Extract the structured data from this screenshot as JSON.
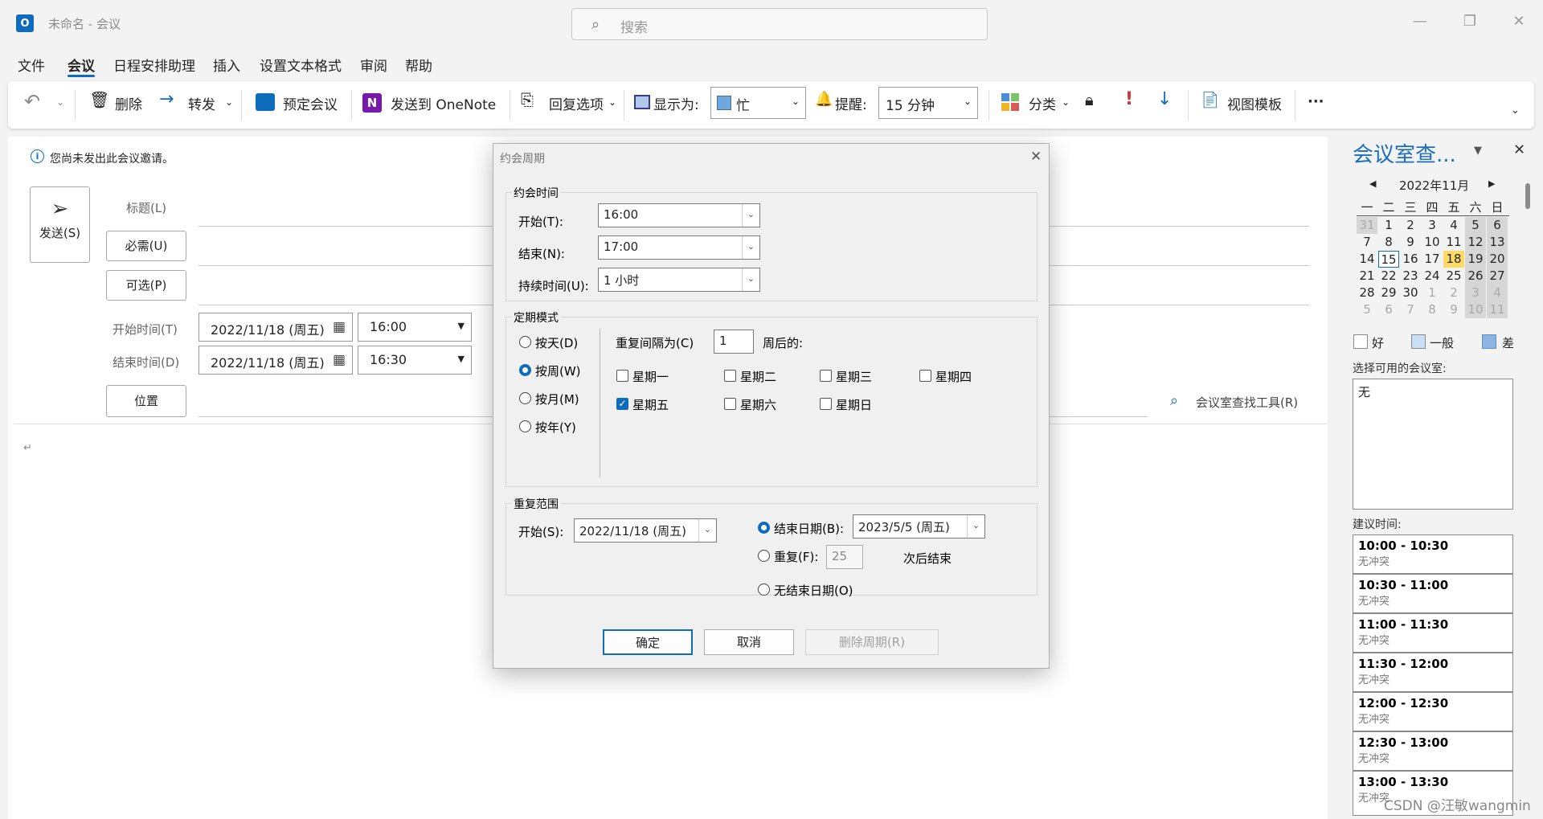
{
  "window": {
    "app_icon": "O",
    "title": "未命名 - 会议",
    "search_placeholder": "搜索",
    "minimize": "—",
    "restore": "❐",
    "close": "✕"
  },
  "menu": [
    "文件",
    "会议",
    "日程安排助理",
    "插入",
    "设置文本格式",
    "审阅",
    "帮助"
  ],
  "ribbon": {
    "undo": "↶",
    "delete": "删除",
    "forward": "转发",
    "book_meeting": "预定会议",
    "send_onenote": "发送到 OneNote",
    "reply_options": "回复选项",
    "show_as_label": "显示为:",
    "show_as_value": "忙",
    "reminder_label": "提醒:",
    "reminder_value": "15 分钟",
    "categorize": "分类",
    "view_templates": "视图模板",
    "more": "···"
  },
  "compose": {
    "info": "您尚未发出此会议邀请。",
    "send": "发送(S)",
    "title_label": "标题(L)",
    "required": "必需(U)",
    "optional": "可选(P)",
    "start_label": "开始时间(T)",
    "end_label": "结束时间(D)",
    "start_date": "2022/11/18 (周五)",
    "start_time": "16:00",
    "end_date": "2022/11/18 (周五)",
    "end_time": "16:30",
    "location": "位置",
    "room_finder_tool": "会议室查找工具(R)",
    "body_mark": "↵"
  },
  "room_finder": {
    "title": "会议室查...",
    "month": "2022年11月",
    "weekdays": [
      "一",
      "二",
      "三",
      "四",
      "五",
      "六",
      "日"
    ],
    "weeks": [
      [
        "31",
        "1",
        "2",
        "3",
        "4",
        "5",
        "6"
      ],
      [
        "7",
        "8",
        "9",
        "10",
        "11",
        "12",
        "13"
      ],
      [
        "14",
        "15",
        "16",
        "17",
        "18",
        "19",
        "20"
      ],
      [
        "21",
        "22",
        "23",
        "24",
        "25",
        "26",
        "27"
      ],
      [
        "28",
        "29",
        "30",
        "1",
        "2",
        "3",
        "4"
      ],
      [
        "5",
        "6",
        "7",
        "8",
        "9",
        "10",
        "11"
      ]
    ],
    "legend_good": "好",
    "legend_fair": "一般",
    "legend_poor": "差",
    "rooms_label": "选择可用的会议室:",
    "rooms_value": "无",
    "suggested_label": "建议时间:",
    "suggestions": [
      {
        "time": "10:00 - 10:30",
        "status": "无冲突"
      },
      {
        "time": "10:30 - 11:00",
        "status": "无冲突"
      },
      {
        "time": "11:00 - 11:30",
        "status": "无冲突"
      },
      {
        "time": "11:30 - 12:00",
        "status": "无冲突"
      },
      {
        "time": "12:00 - 12:30",
        "status": "无冲突"
      },
      {
        "time": "12:30 - 13:00",
        "status": "无冲突"
      },
      {
        "time": "13:00 - 13:30",
        "status": "无冲突"
      }
    ],
    "watermark": "CSDN @汪敏wangmin"
  },
  "dialog": {
    "title": "约会周期",
    "time_group": "约会时间",
    "start_label": "开始(T):",
    "start_value": "16:00",
    "end_label": "结束(N):",
    "end_value": "17:00",
    "duration_label": "持续时间(U):",
    "duration_value": "1 小时",
    "pattern_group": "定期模式",
    "daily": "按天(D)",
    "weekly": "按周(W)",
    "monthly": "按月(M)",
    "yearly": "按年(Y)",
    "recur_every": "重复间隔为(C)",
    "recur_value": "1",
    "weeks_on": "周后的:",
    "days": [
      "星期一",
      "星期二",
      "星期三",
      "星期四",
      "星期五",
      "星期六",
      "星期日"
    ],
    "checked_day": "星期五",
    "range_group": "重复范围",
    "range_start_label": "开始(S):",
    "range_start_value": "2022/11/18 (周五)",
    "end_by": "结束日期(B):",
    "end_by_value": "2023/5/5 (周五)",
    "end_after": "重复(F):",
    "end_after_value": "25",
    "occurrences": "次后结束",
    "no_end": "无结束日期(O)",
    "ok": "确定",
    "cancel": "取消",
    "remove": "删除周期(R)"
  },
  "colors": {
    "accent": "#0f6cbd",
    "today_highlight": "#ffd966",
    "fair": "#c9dff5",
    "poor": "#8db4e2",
    "busy": "#6fa8dc"
  }
}
